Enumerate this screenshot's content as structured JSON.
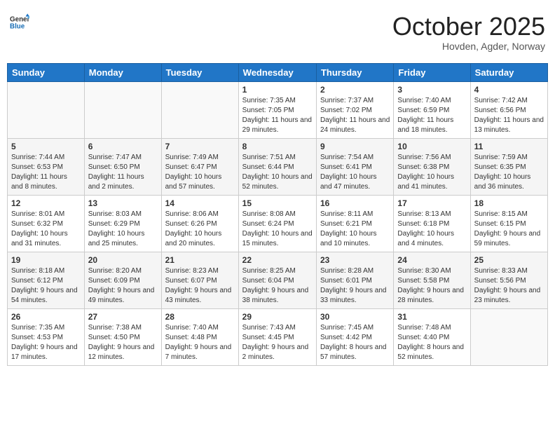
{
  "header": {
    "logo_general": "General",
    "logo_blue": "Blue",
    "month": "October 2025",
    "location": "Hovden, Agder, Norway"
  },
  "weekdays": [
    "Sunday",
    "Monday",
    "Tuesday",
    "Wednesday",
    "Thursday",
    "Friday",
    "Saturday"
  ],
  "weeks": [
    [
      {
        "day": "",
        "sunrise": "",
        "sunset": "",
        "daylight": ""
      },
      {
        "day": "",
        "sunrise": "",
        "sunset": "",
        "daylight": ""
      },
      {
        "day": "",
        "sunrise": "",
        "sunset": "",
        "daylight": ""
      },
      {
        "day": "1",
        "sunrise": "Sunrise: 7:35 AM",
        "sunset": "Sunset: 7:05 PM",
        "daylight": "Daylight: 11 hours and 29 minutes."
      },
      {
        "day": "2",
        "sunrise": "Sunrise: 7:37 AM",
        "sunset": "Sunset: 7:02 PM",
        "daylight": "Daylight: 11 hours and 24 minutes."
      },
      {
        "day": "3",
        "sunrise": "Sunrise: 7:40 AM",
        "sunset": "Sunset: 6:59 PM",
        "daylight": "Daylight: 11 hours and 18 minutes."
      },
      {
        "day": "4",
        "sunrise": "Sunrise: 7:42 AM",
        "sunset": "Sunset: 6:56 PM",
        "daylight": "Daylight: 11 hours and 13 minutes."
      }
    ],
    [
      {
        "day": "5",
        "sunrise": "Sunrise: 7:44 AM",
        "sunset": "Sunset: 6:53 PM",
        "daylight": "Daylight: 11 hours and 8 minutes."
      },
      {
        "day": "6",
        "sunrise": "Sunrise: 7:47 AM",
        "sunset": "Sunset: 6:50 PM",
        "daylight": "Daylight: 11 hours and 2 minutes."
      },
      {
        "day": "7",
        "sunrise": "Sunrise: 7:49 AM",
        "sunset": "Sunset: 6:47 PM",
        "daylight": "Daylight: 10 hours and 57 minutes."
      },
      {
        "day": "8",
        "sunrise": "Sunrise: 7:51 AM",
        "sunset": "Sunset: 6:44 PM",
        "daylight": "Daylight: 10 hours and 52 minutes."
      },
      {
        "day": "9",
        "sunrise": "Sunrise: 7:54 AM",
        "sunset": "Sunset: 6:41 PM",
        "daylight": "Daylight: 10 hours and 47 minutes."
      },
      {
        "day": "10",
        "sunrise": "Sunrise: 7:56 AM",
        "sunset": "Sunset: 6:38 PM",
        "daylight": "Daylight: 10 hours and 41 minutes."
      },
      {
        "day": "11",
        "sunrise": "Sunrise: 7:59 AM",
        "sunset": "Sunset: 6:35 PM",
        "daylight": "Daylight: 10 hours and 36 minutes."
      }
    ],
    [
      {
        "day": "12",
        "sunrise": "Sunrise: 8:01 AM",
        "sunset": "Sunset: 6:32 PM",
        "daylight": "Daylight: 10 hours and 31 minutes."
      },
      {
        "day": "13",
        "sunrise": "Sunrise: 8:03 AM",
        "sunset": "Sunset: 6:29 PM",
        "daylight": "Daylight: 10 hours and 25 minutes."
      },
      {
        "day": "14",
        "sunrise": "Sunrise: 8:06 AM",
        "sunset": "Sunset: 6:26 PM",
        "daylight": "Daylight: 10 hours and 20 minutes."
      },
      {
        "day": "15",
        "sunrise": "Sunrise: 8:08 AM",
        "sunset": "Sunset: 6:24 PM",
        "daylight": "Daylight: 10 hours and 15 minutes."
      },
      {
        "day": "16",
        "sunrise": "Sunrise: 8:11 AM",
        "sunset": "Sunset: 6:21 PM",
        "daylight": "Daylight: 10 hours and 10 minutes."
      },
      {
        "day": "17",
        "sunrise": "Sunrise: 8:13 AM",
        "sunset": "Sunset: 6:18 PM",
        "daylight": "Daylight: 10 hours and 4 minutes."
      },
      {
        "day": "18",
        "sunrise": "Sunrise: 8:15 AM",
        "sunset": "Sunset: 6:15 PM",
        "daylight": "Daylight: 9 hours and 59 minutes."
      }
    ],
    [
      {
        "day": "19",
        "sunrise": "Sunrise: 8:18 AM",
        "sunset": "Sunset: 6:12 PM",
        "daylight": "Daylight: 9 hours and 54 minutes."
      },
      {
        "day": "20",
        "sunrise": "Sunrise: 8:20 AM",
        "sunset": "Sunset: 6:09 PM",
        "daylight": "Daylight: 9 hours and 49 minutes."
      },
      {
        "day": "21",
        "sunrise": "Sunrise: 8:23 AM",
        "sunset": "Sunset: 6:07 PM",
        "daylight": "Daylight: 9 hours and 43 minutes."
      },
      {
        "day": "22",
        "sunrise": "Sunrise: 8:25 AM",
        "sunset": "Sunset: 6:04 PM",
        "daylight": "Daylight: 9 hours and 38 minutes."
      },
      {
        "day": "23",
        "sunrise": "Sunrise: 8:28 AM",
        "sunset": "Sunset: 6:01 PM",
        "daylight": "Daylight: 9 hours and 33 minutes."
      },
      {
        "day": "24",
        "sunrise": "Sunrise: 8:30 AM",
        "sunset": "Sunset: 5:58 PM",
        "daylight": "Daylight: 9 hours and 28 minutes."
      },
      {
        "day": "25",
        "sunrise": "Sunrise: 8:33 AM",
        "sunset": "Sunset: 5:56 PM",
        "daylight": "Daylight: 9 hours and 23 minutes."
      }
    ],
    [
      {
        "day": "26",
        "sunrise": "Sunrise: 7:35 AM",
        "sunset": "Sunset: 4:53 PM",
        "daylight": "Daylight: 9 hours and 17 minutes."
      },
      {
        "day": "27",
        "sunrise": "Sunrise: 7:38 AM",
        "sunset": "Sunset: 4:50 PM",
        "daylight": "Daylight: 9 hours and 12 minutes."
      },
      {
        "day": "28",
        "sunrise": "Sunrise: 7:40 AM",
        "sunset": "Sunset: 4:48 PM",
        "daylight": "Daylight: 9 hours and 7 minutes."
      },
      {
        "day": "29",
        "sunrise": "Sunrise: 7:43 AM",
        "sunset": "Sunset: 4:45 PM",
        "daylight": "Daylight: 9 hours and 2 minutes."
      },
      {
        "day": "30",
        "sunrise": "Sunrise: 7:45 AM",
        "sunset": "Sunset: 4:42 PM",
        "daylight": "Daylight: 8 hours and 57 minutes."
      },
      {
        "day": "31",
        "sunrise": "Sunrise: 7:48 AM",
        "sunset": "Sunset: 4:40 PM",
        "daylight": "Daylight: 8 hours and 52 minutes."
      },
      {
        "day": "",
        "sunrise": "",
        "sunset": "",
        "daylight": ""
      }
    ]
  ]
}
